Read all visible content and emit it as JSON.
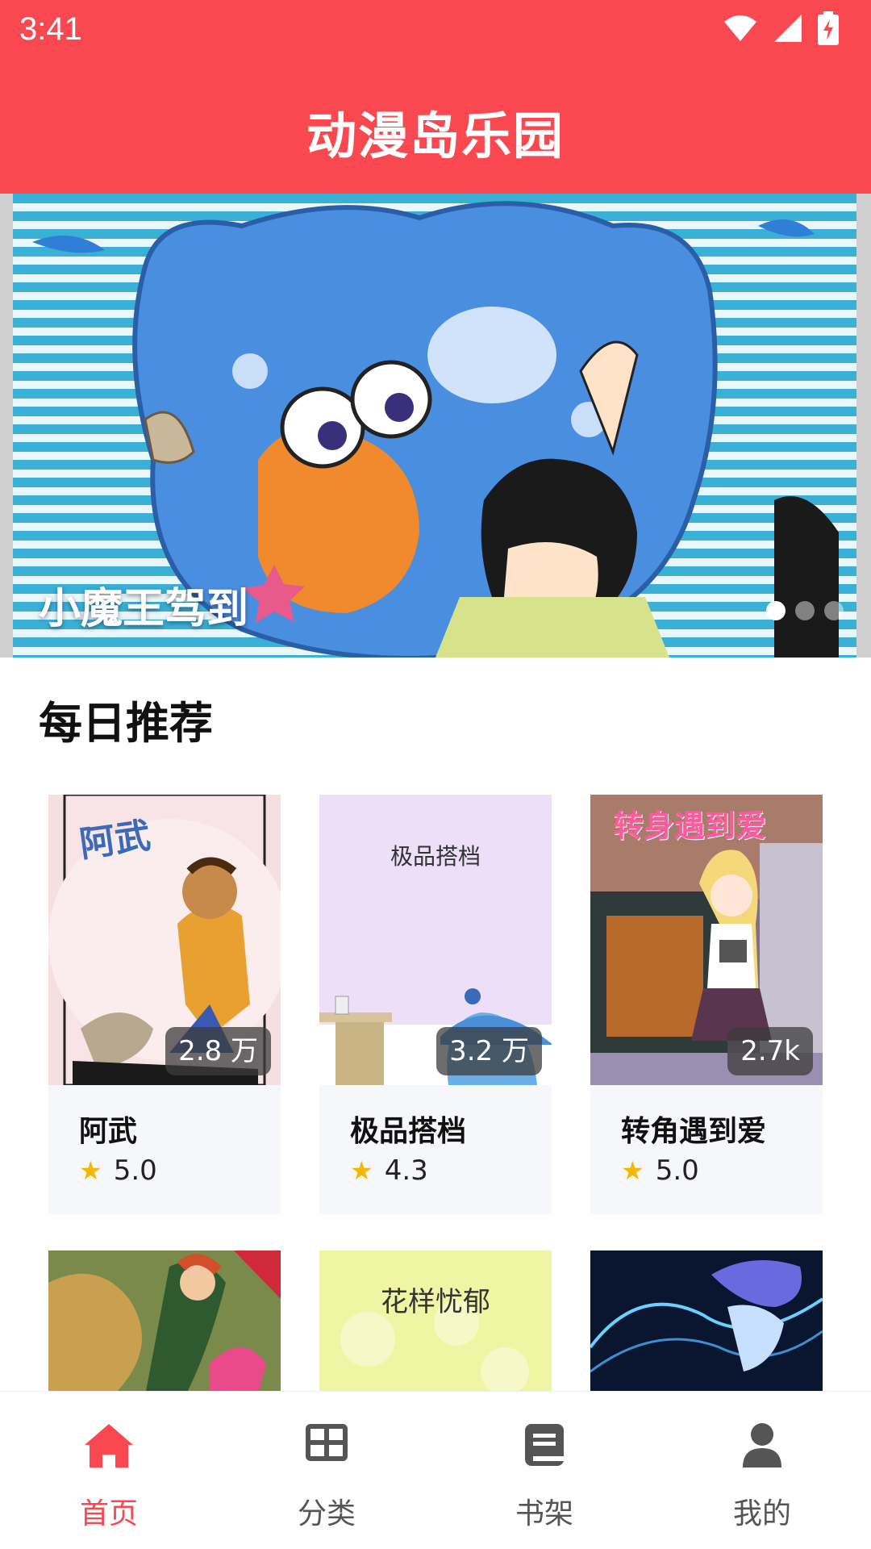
{
  "status_bar": {
    "time": "3:41"
  },
  "header": {
    "title": "动漫岛乐园"
  },
  "banner": {
    "title": "小魔王驾到",
    "page_count": 3,
    "active_index": 0
  },
  "section": {
    "title": "每日推荐"
  },
  "cards": [
    {
      "title": "阿武",
      "views": "2.8 万",
      "rating": "5.0",
      "cover_text": "阿武"
    },
    {
      "title": "极品搭档",
      "views": "3.2 万",
      "rating": "4.3",
      "cover_text": "极品搭档"
    },
    {
      "title": "转角遇到爱",
      "views": "2.7k",
      "rating": "5.0",
      "cover_text": "转身遇到爱"
    }
  ],
  "cards_row2": [
    {
      "cover_text": ""
    },
    {
      "cover_text": "花样忧郁"
    },
    {
      "cover_text": ""
    }
  ],
  "nav": [
    {
      "label": "首页",
      "icon": "home-icon",
      "active": true
    },
    {
      "label": "分类",
      "icon": "grid-icon",
      "active": false
    },
    {
      "label": "书架",
      "icon": "book-icon",
      "active": false
    },
    {
      "label": "我的",
      "icon": "user-icon",
      "active": false
    }
  ],
  "colors": {
    "brand": "#f9484f",
    "star": "#f7b500"
  }
}
